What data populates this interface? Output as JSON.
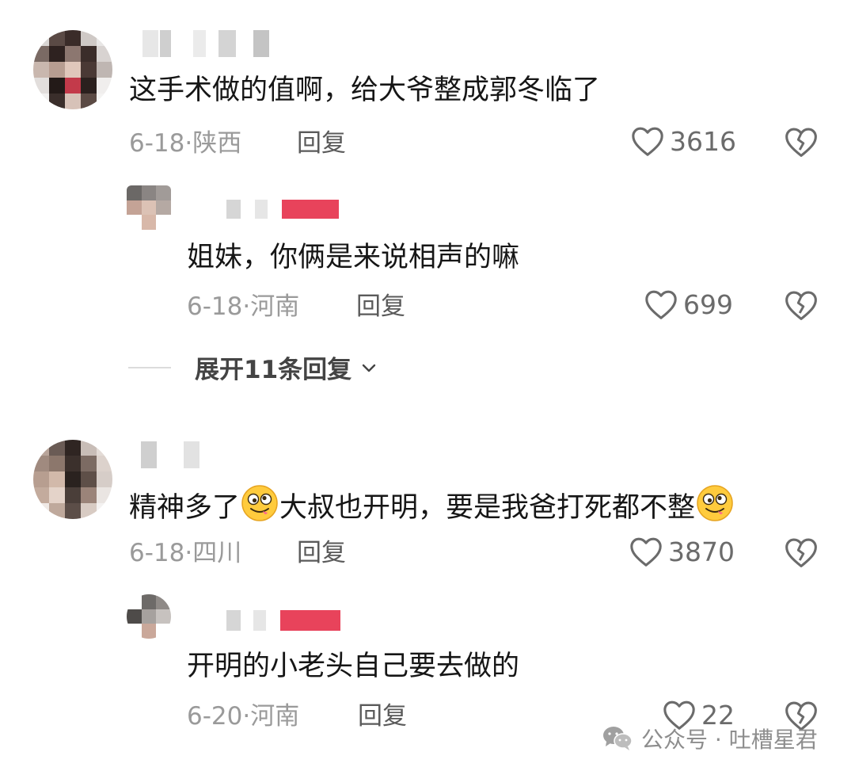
{
  "comments": [
    {
      "text": "这手术做的值啊，给大爷整成郭冬临了",
      "date_location": "6-18·陕西",
      "reply_label": "回复",
      "likes": "3616",
      "reply": {
        "text": "姐妹，你俩是来说相声的嘛",
        "date_location": "6-18·河南",
        "reply_label": "回复",
        "likes": "699"
      },
      "expand_label": "展开11条回复"
    },
    {
      "text_part1": "精神多了",
      "text_part2": "大叔也开明，要是我爸打死都不整",
      "date_location": "6-18·四川",
      "reply_label": "回复",
      "likes": "3870",
      "reply": {
        "text": "开明的小老头自己要去做的",
        "date_location": "6-20·河南",
        "reply_label": "回复",
        "likes": "22"
      }
    }
  ],
  "watermark": {
    "text": "公众号 · 吐槽星君",
    "icon": "wechat-icon"
  },
  "icons": {
    "like": "heart-outline-icon",
    "dislike": "broken-heart-icon",
    "expand": "chevron-down-icon",
    "emoji": "drooling-face-emoji-icon"
  }
}
